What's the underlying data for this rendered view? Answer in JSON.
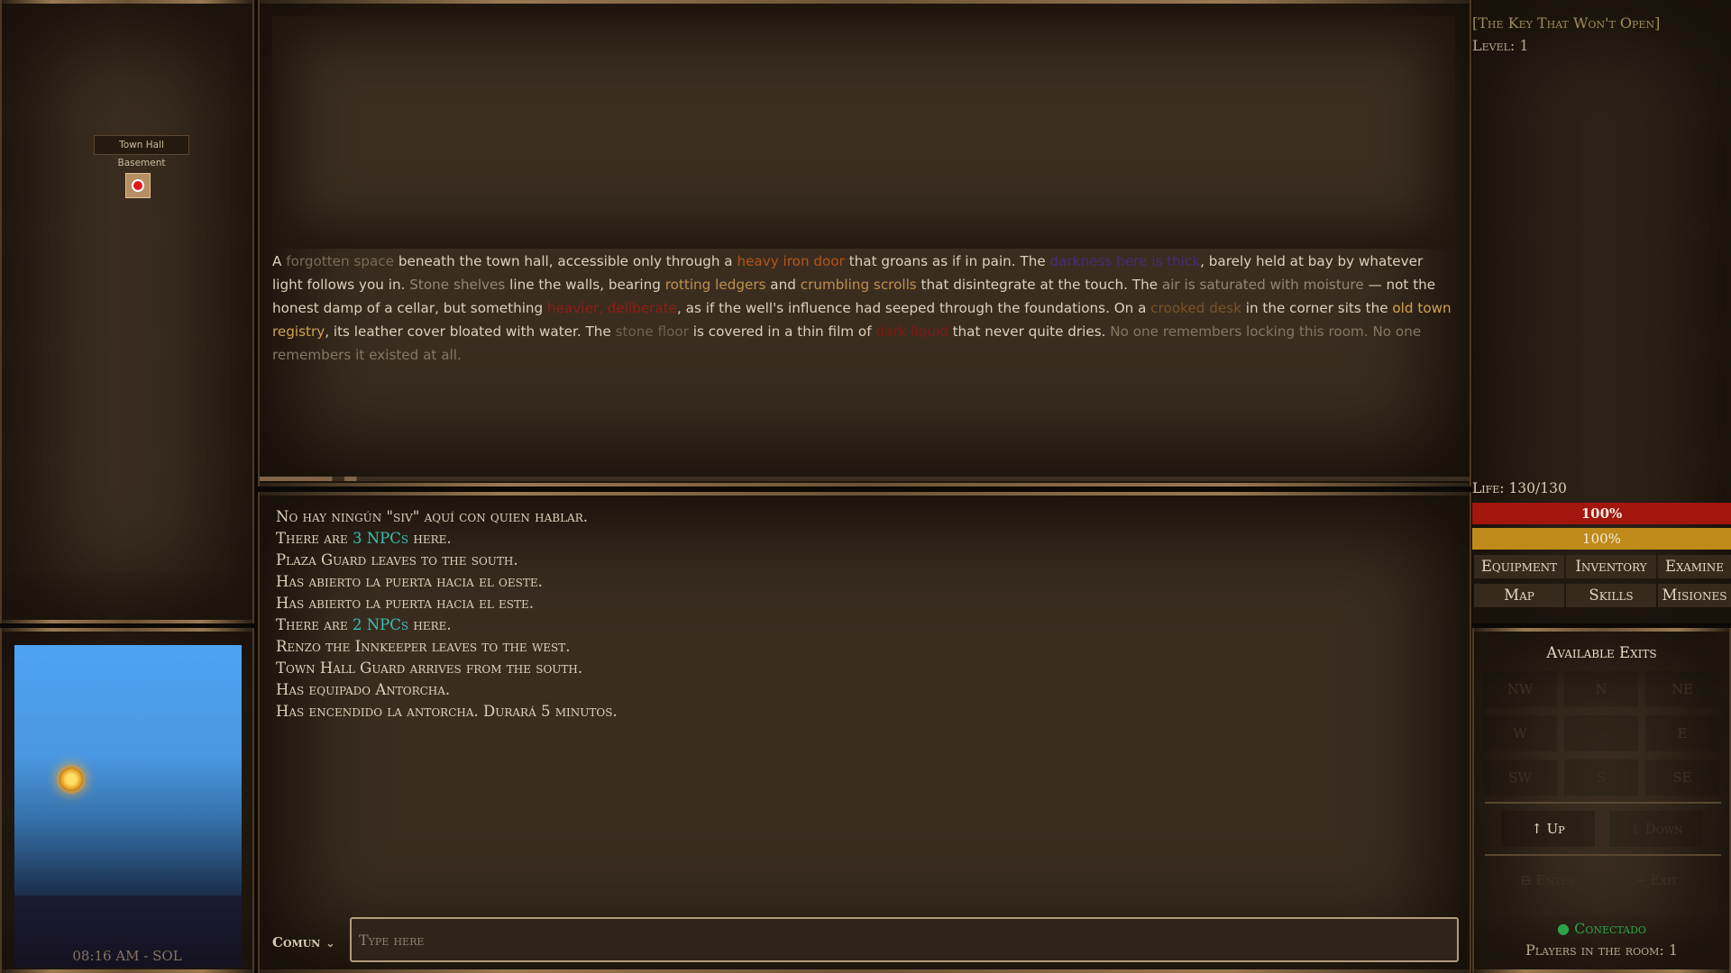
{
  "minimap": {
    "room_label": "Town Hall Basement"
  },
  "skybox": {
    "clock": "08:16 AM - SOL"
  },
  "room": {
    "description": [
      {
        "t": "A "
      },
      {
        "t": "forgotten space",
        "c": "#7a6a55"
      },
      {
        "t": " beneath the town hall, accessible only through a "
      },
      {
        "t": "heavy iron door",
        "c": "#b45418"
      },
      {
        "t": " that groans as if in pain. The "
      },
      {
        "t": "darkness here is thick",
        "c": "#4a2a78"
      },
      {
        "t": ", barely held at bay by whatever light follows you in. "
      },
      {
        "t": "Stone shelves",
        "c": "#948672"
      },
      {
        "t": " line the walls, bearing "
      },
      {
        "t": "rotting ledgers",
        "c": "#c0904e"
      },
      {
        "t": " and "
      },
      {
        "t": "crumbling scrolls",
        "c": "#c0904e"
      },
      {
        "t": " that disintegrate at the touch. The "
      },
      {
        "t": "air is saturated with moisture",
        "c": "#948672"
      },
      {
        "t": " — not the honest damp of a cellar, but something "
      },
      {
        "t": "heavier, deliberate",
        "c": "#8e1f12"
      },
      {
        "t": ", as if the well's influence had seeped through the foundations. On a "
      },
      {
        "t": "crooked desk",
        "c": "#7c5220"
      },
      {
        "t": " in the corner sits the "
      },
      {
        "t": "old town registry",
        "c": "#d5a24c"
      },
      {
        "t": ", its leather cover bloated with water. The "
      },
      {
        "t": "stone floor",
        "c": "#6f6250"
      },
      {
        "t": " is covered in a thin film of "
      },
      {
        "t": "dark liquid",
        "c": "#7c1a12"
      },
      {
        "t": " that never quite dries. "
      },
      {
        "t": "No one remembers locking this room. No one remembers it existed at all.",
        "c": "#857763"
      }
    ]
  },
  "chat": {
    "lines": [
      [
        "No hay ningún \"siv\" aquí con quien hablar."
      ],
      [
        "There are ",
        "3 NPCs",
        " here."
      ],
      [
        "Plaza Guard leaves to the south."
      ],
      [
        "Has abierto la puerta hacia el oeste."
      ],
      [
        "Has abierto la puerta hacia el este."
      ],
      [
        "There are ",
        "2 NPCs",
        " here."
      ],
      [
        "Renzo the Innkeeper leaves to the west."
      ],
      [
        "Town Hall Guard arrives from the south."
      ],
      [
        "Has equipado Antorcha."
      ],
      [
        "Has encendido la antorcha. Durará 5 minutos."
      ]
    ],
    "accent_color": "#37c0b6",
    "channel": "Comun",
    "input_placeholder": "Type here",
    "input_value": ""
  },
  "sidebar": {
    "quest_title": "[The Key That Won't Open]",
    "quest_level": "Level: 1",
    "life_label": "Life: 130/130",
    "life_percent": "100%",
    "mana_percent": "100%",
    "life_fraction": 1.0,
    "mana_fraction": 1.0,
    "life_color": "#a3160e",
    "mana_color": "#bf8a1a",
    "menu": [
      "Equipment",
      "Inventory",
      "Examine",
      "Map",
      "Skills",
      "Misiones"
    ]
  },
  "exits": {
    "title": "Available Exits",
    "grid": [
      "NW",
      "N",
      "NE",
      "W",
      "",
      "E",
      "SW",
      "S",
      "SE"
    ],
    "up": "↑ Up",
    "down": "↓ Down",
    "enter": "⊟ Enter",
    "exit": "→ Exit",
    "status": "● Conectado",
    "players": "Players in the room: 1"
  }
}
